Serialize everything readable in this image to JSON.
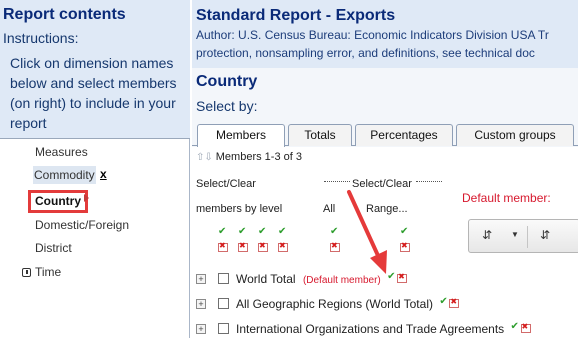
{
  "left": {
    "title": "Report contents",
    "instructions_label": "Instructions:",
    "instructions_body": "Click on dimension names below and select members (on right) to include in your report",
    "tree": [
      {
        "label": "Measures"
      },
      {
        "label": "Commodity",
        "marker": "x"
      },
      {
        "label": "Country",
        "selected": true
      },
      {
        "label": "Domestic/Foreign"
      },
      {
        "label": "District"
      },
      {
        "label": "Time"
      }
    ]
  },
  "report": {
    "title": "Standard Report - Exports",
    "author": "Author: U.S. Census Bureau: Economic Indicators Division USA Tr",
    "protection": "protection, nonsampling error, and definitions, see technical doc",
    "dimension_title": "Country",
    "select_by": "Select by:"
  },
  "tabs": [
    {
      "label": "Members",
      "active": true
    },
    {
      "label": "Totals"
    },
    {
      "label": "Percentages"
    },
    {
      "label": "Custom groups"
    }
  ],
  "members": {
    "count_text": "Members 1-3 of 3",
    "select_clear_level_1": "Select/Clear",
    "select_clear_level_2": "members by level",
    "select_clear_right": "Select/Clear",
    "all_label": "All",
    "range_label": "Range...",
    "default_member_label": "Default member:",
    "rows": [
      {
        "label": "World Total",
        "default_tag": "(Default member)"
      },
      {
        "label": "All Geographic Regions (World Total)"
      },
      {
        "label": "International Organizations and Trade Agreements"
      }
    ]
  },
  "colors": {
    "header_bg": "#dfe9f6",
    "title_blue": "#0a2a78",
    "highlight_red": "#e33b3b",
    "check_green": "#2e9e2e",
    "clear_red": "#d61d1d"
  }
}
